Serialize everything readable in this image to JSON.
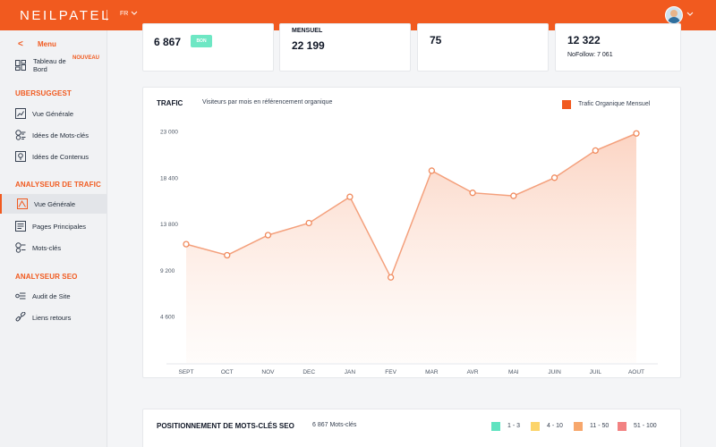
{
  "header": {
    "brand": "NEILPATEL",
    "language": "FR",
    "language_chevron_icon": "chevron-down-icon",
    "avatar_chevron_icon": "chevron-down-icon"
  },
  "sidebar": {
    "menu_back_glyph": "<",
    "menu_label": "Menu",
    "dashboard": {
      "label": "Tableau de Bord",
      "badge": "NOUVEAU",
      "icon": "dashboard-icon"
    },
    "sections": [
      {
        "title": "UBERSUGGEST",
        "items": [
          {
            "label": "Vue Générale",
            "icon": "overview-icon",
            "active": false
          },
          {
            "label": "Idées de Mots-clés",
            "icon": "keyword-ideas-icon",
            "active": false
          },
          {
            "label": "Idées de Contenus",
            "icon": "content-ideas-icon",
            "active": false
          }
        ]
      },
      {
        "title": "ANALYSEUR DE TRAFIC",
        "items": [
          {
            "label": "Vue Générale",
            "icon": "traffic-overview-icon",
            "active": true
          },
          {
            "label": "Pages Principales",
            "icon": "top-pages-icon",
            "active": false
          },
          {
            "label": "Mots-clés",
            "icon": "keywords-icon",
            "active": false
          }
        ]
      },
      {
        "title": "ANALYSEUR SEO",
        "items": [
          {
            "label": "Audit de Site",
            "icon": "site-audit-icon",
            "active": false
          },
          {
            "label": "Liens retours",
            "icon": "backlinks-icon",
            "active": false
          }
        ]
      }
    ]
  },
  "stats": {
    "keywords_value": "6 867",
    "keywords_badge": "BON",
    "traffic_label": "MENSUEL",
    "traffic_value": "22 199",
    "domain_score_value": "75",
    "backlinks_value": "12 322",
    "nofollow_text": "NoFollow: 7 061"
  },
  "traffic_chart": {
    "title": "TRAFIC",
    "subtitle": "Visiteurs par mois en référencement organique",
    "accent_color": "#f15a1f",
    "chart_data": {
      "type": "area",
      "title": "TRAFIC",
      "subtitle": "Visiteurs par mois en référencement organique",
      "categories": [
        "SEPT",
        "OCT",
        "NOV",
        "DEC",
        "JAN",
        "FEV",
        "MAR",
        "AVR",
        "MAI",
        "JUIN",
        "JUIL",
        "AOUT"
      ],
      "series": [
        {
          "name": "Trafic Organique Mensuel",
          "values": [
            11800,
            10700,
            12700,
            13900,
            16500,
            8500,
            19100,
            16900,
            16600,
            18400,
            21100,
            22800
          ]
        }
      ],
      "y_ticks": [
        {
          "value": 23000,
          "label": "23 000"
        },
        {
          "value": 18400,
          "label": "18 400"
        },
        {
          "value": 13800,
          "label": "13 800"
        },
        {
          "value": 9200,
          "label": "9 200"
        },
        {
          "value": 4600,
          "label": "4 600"
        }
      ],
      "ylim": [
        0,
        23000
      ],
      "grid": false,
      "legend_position": "top-right",
      "color": "#f15a1f"
    }
  },
  "positions": {
    "title": "POSITIONNEMENT DE MOTS-CLÉS SEO",
    "count": "6 867 Mots-clés",
    "legend": [
      {
        "label": "1 - 3",
        "color": "#5fe3c0"
      },
      {
        "label": "4 - 10",
        "color": "#fcd46a"
      },
      {
        "label": "11 - 50",
        "color": "#f7a76c"
      },
      {
        "label": "51 - 100",
        "color": "#f28282"
      }
    ]
  }
}
